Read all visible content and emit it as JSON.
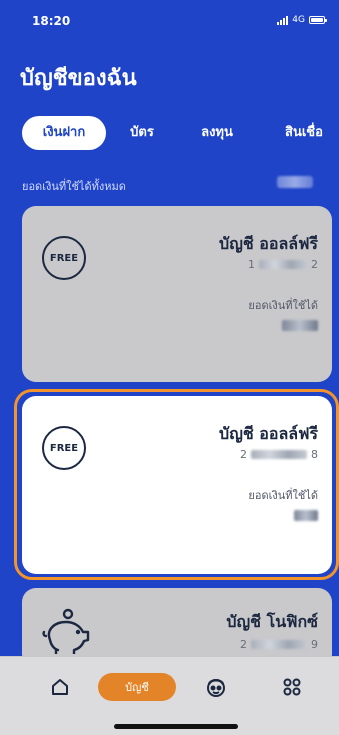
{
  "status_bar": {
    "time": "18:20",
    "network": "4G"
  },
  "page": {
    "title": "บัญชีของฉัน"
  },
  "tabs": [
    {
      "label": "เงินฝาก",
      "active": true
    },
    {
      "label": "บัตร",
      "active": false
    },
    {
      "label": "ลงทุน",
      "active": false
    },
    {
      "label": "สินเชื่อ",
      "active": false
    }
  ],
  "summary": {
    "total_label": "ยอดเงินที่ใช้ได้ทั้งหมด"
  },
  "accounts": [
    {
      "icon": "free-badge-icon",
      "badge_text": "FREE",
      "name": "บัญชี ออลล์ฟรี",
      "number_prefix": "1",
      "number_suffix": "2",
      "available_label": "ยอดเงินที่ใช้ได้",
      "highlighted": false
    },
    {
      "icon": "free-badge-icon",
      "badge_text": "FREE",
      "name": "บัญชี ออลล์ฟรี",
      "number_prefix": "2",
      "number_suffix": "8",
      "available_label": "ยอดเงินที่ใช้ได้",
      "highlighted": true
    },
    {
      "icon": "piggy-bank-icon",
      "name": "บัญชี โนฟิกซ์",
      "number_prefix": "2",
      "number_suffix": "9",
      "highlighted": false
    }
  ],
  "bottom_nav": [
    {
      "icon": "home-icon"
    },
    {
      "label": "บัญชี",
      "active": true
    },
    {
      "icon": "face-icon"
    },
    {
      "icon": "menu-grid-icon"
    }
  ],
  "colors": {
    "primary": "#1f44c8",
    "highlight_border": "#f2932b",
    "nav_active": "#e38429",
    "card_inactive": "#c9c9cc",
    "card_active": "#ffffff",
    "text_dark": "#1c2840"
  }
}
